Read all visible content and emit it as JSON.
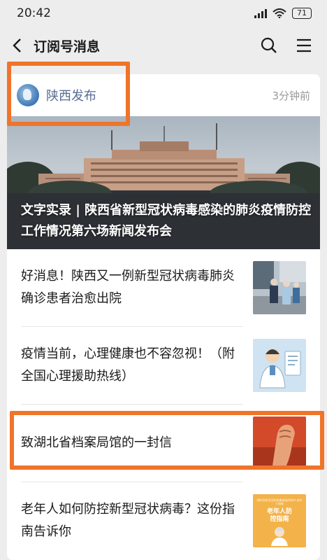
{
  "status_bar": {
    "time": "20:42",
    "battery": "71"
  },
  "nav": {
    "title": "订阅号消息"
  },
  "account": {
    "name": "陕西发布",
    "time_ago": "3分钟前"
  },
  "hero": {
    "title": "文字实录 | 陕西省新型冠状病毒感染的肺炎疫情防控工作情况第六场新闻发布会"
  },
  "articles": [
    {
      "title": "好消息！陕西又一例新型冠状病毒肺炎确诊患者治愈出院",
      "thumb": "hospital-photo"
    },
    {
      "title": "疫情当前，心理健康也不容忽视！（附全国心理援助热线）",
      "thumb": "doctor-illustration"
    },
    {
      "title": "致湖北省档案局馆的一封信",
      "thumb": "fist-map-image"
    },
    {
      "title": "老年人如何防控新型冠状病毒？这份指南告诉你",
      "thumb": "elderly-guide-poster"
    }
  ],
  "thumb_texts": {
    "guide_top": "湖防控新型冠状病毒感染的肺炎·老年人指南",
    "guide_main": "老年人防控指南"
  },
  "colors": {
    "highlight": "#f0742a",
    "link": "#576b95",
    "background": "#ededed"
  }
}
